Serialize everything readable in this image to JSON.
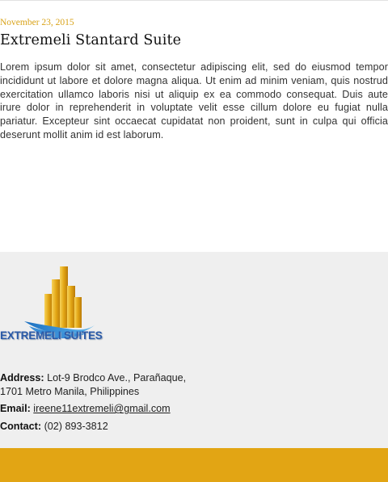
{
  "post": {
    "date": "November 23, 2015",
    "title": "Extremeli Stantard Suite",
    "body": "Lorem ipsum dolor sit amet, consectetur adipiscing elit, sed do eiusmod tempor incididunt ut labore et dolore magna aliqua. Ut enim ad minim veniam, quis nostrud exercitation ullamco laboris nisi ut aliquip ex ea commodo consequat. Duis aute irure dolor in reprehenderit in voluptate velit esse cillum dolore eu fugiat nulla pariatur. Excepteur sint occaecat cupidatat non proident, sunt in culpa qui officia deserunt mollit anim id est laborum."
  },
  "footer": {
    "logo_text": "EXTREMELI SUITES",
    "address_label": "Address:",
    "address_line1": "Lot-9 Brodco Ave., Parañaque,",
    "address_line2": "1701 Metro Manila, Philippines",
    "email_label": "Email:",
    "email": "ireene11extremeli@gmail.com",
    "contact_label": "Contact:",
    "contact": "(02) 893-3812"
  },
  "colors": {
    "accent": "#e2a514",
    "logo_blue": "#2a5aa8"
  }
}
